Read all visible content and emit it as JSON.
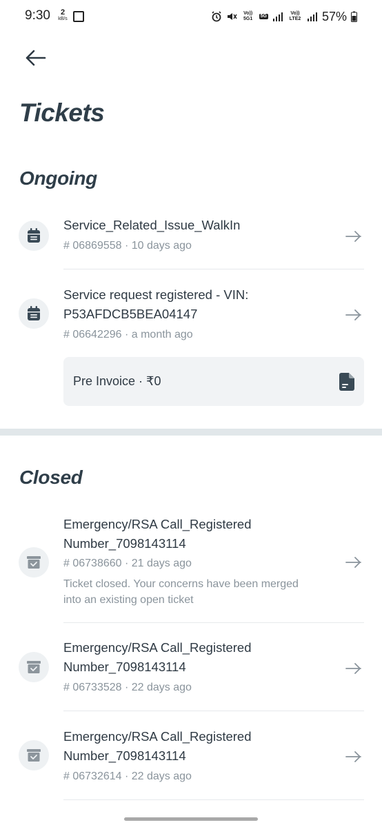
{
  "status_bar": {
    "time": "9:30",
    "speed_value": "2",
    "speed_unit": "kB/s",
    "sim1": "Vo)) 5G1",
    "sim1_net": "5G",
    "sim2": "Vo)) LTE2",
    "battery": "57%"
  },
  "page": {
    "title": "Tickets"
  },
  "ongoing": {
    "heading": "Ongoing",
    "tickets": [
      {
        "name": "Service_Related_Issue_WalkIn",
        "meta": "# 06869558 · 10 days ago"
      },
      {
        "name": "Service request registered - VIN: P53AFDCB5BEA04147",
        "meta": "# 06642296 · a month ago",
        "invoice": "Pre Invoice · ₹0"
      }
    ]
  },
  "closed": {
    "heading": "Closed",
    "tickets": [
      {
        "name": "Emergency/RSA Call_Registered Number_7098143114",
        "meta": "# 06738660 · 21 days ago",
        "note": "Ticket closed. Your concerns have been merged into an existing open ticket"
      },
      {
        "name": "Emergency/RSA Call_Registered Number_7098143114",
        "meta": "# 06733528 · 22 days ago"
      },
      {
        "name": "Emergency/RSA Call_Registered Number_7098143114",
        "meta": "# 06732614 · 22 days ago"
      }
    ]
  },
  "colors": {
    "text_primary": "#2f3a44",
    "text_secondary": "#8a949c",
    "icon_bg": "#eef1f3",
    "ongoing_icon": "#3a4a56",
    "closed_icon": "#8c959c",
    "separator": "#e1e7ea"
  },
  "icons": {
    "back": "arrow-left-icon",
    "ongoing": "calendar-icon",
    "closed": "archive-check-icon",
    "row": "arrow-right-icon",
    "invoice": "document-icon"
  }
}
